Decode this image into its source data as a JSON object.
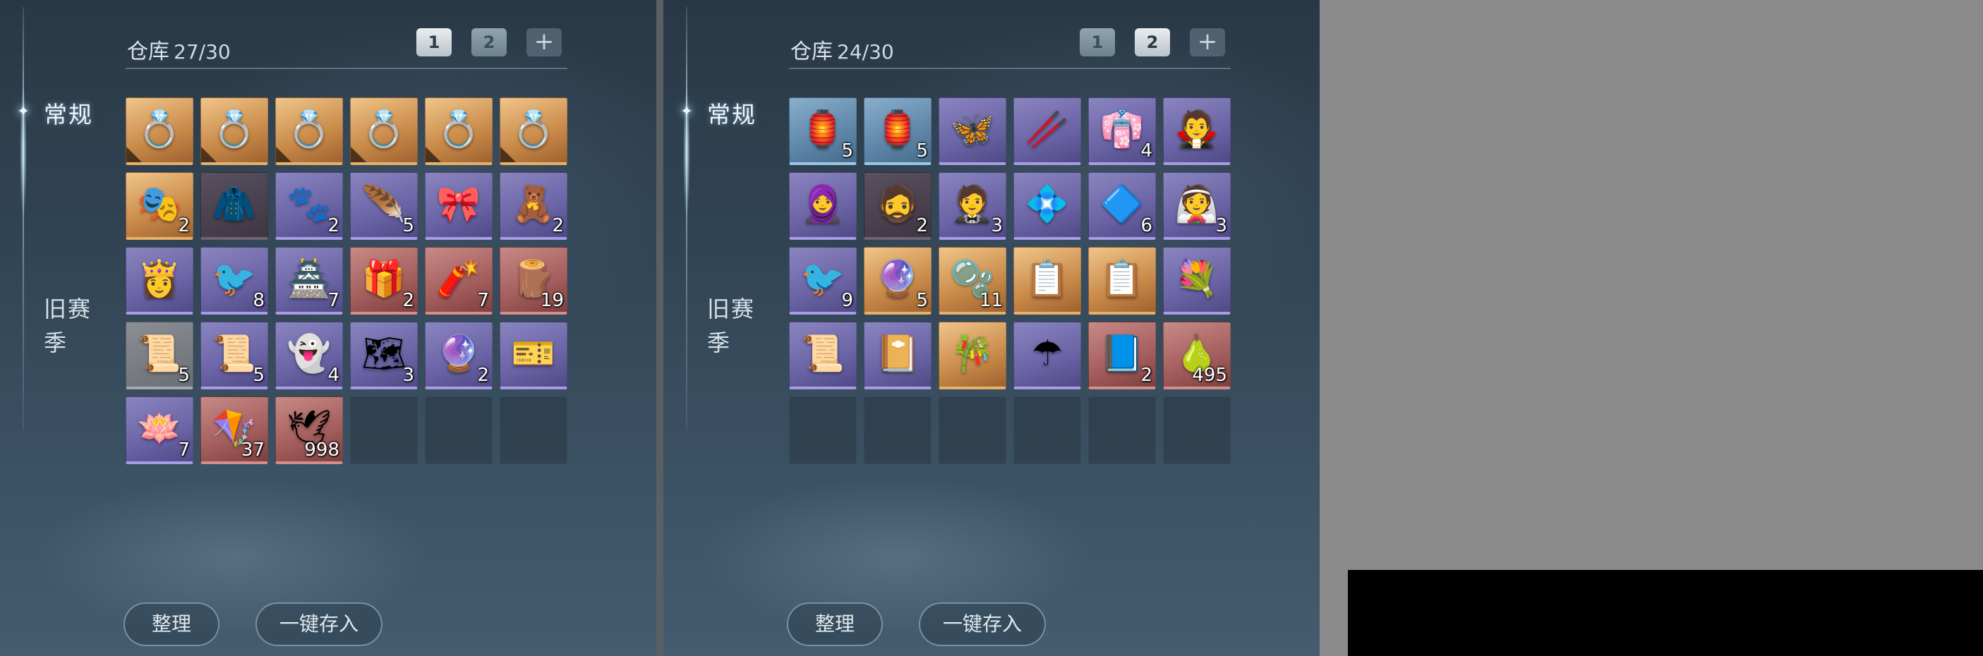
{
  "panels": [
    {
      "title": "仓库",
      "count": "27/30",
      "tabs": {
        "normal": "常规",
        "old_season": "旧赛季"
      },
      "pages": [
        "1",
        "2",
        "+"
      ],
      "active_page": "1",
      "buttons": {
        "sort": "整理",
        "store_all": "一键存入"
      },
      "items": [
        {
          "icon": "ring-icon",
          "glyph": "💍",
          "rarity": "gold",
          "qty": ""
        },
        {
          "icon": "ring-icon",
          "glyph": "💍",
          "rarity": "gold",
          "qty": ""
        },
        {
          "icon": "ring-icon",
          "glyph": "💍",
          "rarity": "gold",
          "qty": ""
        },
        {
          "icon": "ring-icon",
          "glyph": "💍",
          "rarity": "gold",
          "qty": ""
        },
        {
          "icon": "ring-icon",
          "glyph": "💍",
          "rarity": "gold",
          "qty": ""
        },
        {
          "icon": "ring-icon",
          "glyph": "💍",
          "rarity": "gold",
          "qty": ""
        },
        {
          "icon": "mask-icon",
          "glyph": "🎭",
          "rarity": "gold",
          "qty": "2"
        },
        {
          "icon": "cloak-icon",
          "glyph": "🧥",
          "rarity": "dark",
          "qty": ""
        },
        {
          "icon": "beast-icon",
          "glyph": "🐾",
          "rarity": "purple",
          "qty": "2"
        },
        {
          "icon": "feather-icon",
          "glyph": "🪶",
          "rarity": "purple",
          "qty": "5"
        },
        {
          "icon": "bow-ornament-icon",
          "glyph": "🎀",
          "rarity": "purple",
          "qty": ""
        },
        {
          "icon": "plush-icon",
          "glyph": "🧸",
          "rarity": "purple",
          "qty": "2"
        },
        {
          "icon": "character-icon",
          "glyph": "👸",
          "rarity": "purple",
          "qty": ""
        },
        {
          "icon": "bird-icon",
          "glyph": "🐦",
          "rarity": "purple",
          "qty": "8"
        },
        {
          "icon": "pavilion-icon",
          "glyph": "🏯",
          "rarity": "purple",
          "qty": "7"
        },
        {
          "icon": "gift-box-icon",
          "glyph": "🎁",
          "rarity": "red",
          "qty": "2"
        },
        {
          "icon": "firecracker-icon",
          "glyph": "🧨",
          "rarity": "red",
          "qty": "7"
        },
        {
          "icon": "scroll-tube-icon",
          "glyph": "🪵",
          "rarity": "red",
          "qty": "19"
        },
        {
          "icon": "scroll-icon",
          "glyph": "📜",
          "rarity": "grey",
          "qty": "5"
        },
        {
          "icon": "scroll-icon",
          "glyph": "📜",
          "rarity": "purple",
          "qty": "5"
        },
        {
          "icon": "spirit-icon",
          "glyph": "👻",
          "rarity": "purple",
          "qty": "4"
        },
        {
          "icon": "map-fragment-icon",
          "glyph": "🗺",
          "rarity": "purple",
          "qty": "3"
        },
        {
          "icon": "pearl-icon",
          "glyph": "🔮",
          "rarity": "purple",
          "qty": "2"
        },
        {
          "icon": "ticket-icon",
          "glyph": "🎫",
          "rarity": "purple",
          "qty": ""
        },
        {
          "icon": "lotus-icon",
          "glyph": "🪷",
          "rarity": "purple",
          "qty": "7"
        },
        {
          "icon": "kite-icon",
          "glyph": "🪁",
          "rarity": "red",
          "qty": "37"
        },
        {
          "icon": "paper-crane-icon",
          "glyph": "🕊",
          "rarity": "red",
          "qty": "998"
        },
        {
          "icon": "",
          "glyph": "",
          "rarity": "empty",
          "qty": ""
        },
        {
          "icon": "",
          "glyph": "",
          "rarity": "empty",
          "qty": ""
        },
        {
          "icon": "",
          "glyph": "",
          "rarity": "empty",
          "qty": ""
        }
      ]
    },
    {
      "title": "仓库",
      "count": "24/30",
      "tabs": {
        "normal": "常规",
        "old_season": "旧赛季"
      },
      "pages": [
        "1",
        "2",
        "+"
      ],
      "active_page": "2",
      "buttons": {
        "sort": "整理",
        "store_all": "一键存入"
      },
      "items": [
        {
          "icon": "lantern-icon",
          "glyph": "🏮",
          "rarity": "blue",
          "qty": "5"
        },
        {
          "icon": "lantern-icon",
          "glyph": "🏮",
          "rarity": "blue",
          "qty": "5"
        },
        {
          "icon": "butterfly-icon",
          "glyph": "🦋",
          "rarity": "purple",
          "qty": ""
        },
        {
          "icon": "chopsticks-icon",
          "glyph": "🥢",
          "rarity": "purple",
          "qty": ""
        },
        {
          "icon": "robe-icon",
          "glyph": "👘",
          "rarity": "purple",
          "qty": "4"
        },
        {
          "icon": "character-icon",
          "glyph": "🧛",
          "rarity": "purple",
          "qty": ""
        },
        {
          "icon": "character-icon",
          "glyph": "🧕",
          "rarity": "purple",
          "qty": ""
        },
        {
          "icon": "character-icon",
          "glyph": "🧔",
          "rarity": "dark",
          "qty": "2"
        },
        {
          "icon": "character-icon",
          "glyph": "🤵",
          "rarity": "purple",
          "qty": "3"
        },
        {
          "icon": "crystal-flower-icon",
          "glyph": "💠",
          "rarity": "purple",
          "qty": ""
        },
        {
          "icon": "crystal-shard-icon",
          "glyph": "🔷",
          "rarity": "purple",
          "qty": "6"
        },
        {
          "icon": "character-icon",
          "glyph": "👰",
          "rarity": "purple",
          "qty": "3"
        },
        {
          "icon": "bird-icon",
          "glyph": "🐦",
          "rarity": "purple",
          "qty": "9"
        },
        {
          "icon": "orb-icon",
          "glyph": "🔮",
          "rarity": "gold",
          "qty": "5"
        },
        {
          "icon": "orb-icon",
          "glyph": "🫧",
          "rarity": "gold",
          "qty": "11"
        },
        {
          "icon": "manual-icon",
          "glyph": "📋",
          "rarity": "gold",
          "qty": ""
        },
        {
          "icon": "manual-icon",
          "glyph": "📋",
          "rarity": "gold",
          "qty": ""
        },
        {
          "icon": "blue-flower-icon",
          "glyph": "💐",
          "rarity": "purple",
          "qty": ""
        },
        {
          "icon": "scroll-icon",
          "glyph": "📜",
          "rarity": "purple",
          "qty": ""
        },
        {
          "icon": "book-icon",
          "glyph": "📔",
          "rarity": "purple",
          "qty": ""
        },
        {
          "icon": "bamboo-tube-icon",
          "glyph": "🎋",
          "rarity": "gold",
          "qty": ""
        },
        {
          "icon": "umbrella-icon",
          "glyph": "☂",
          "rarity": "purple",
          "qty": ""
        },
        {
          "icon": "book-icon",
          "glyph": "📘",
          "rarity": "red",
          "qty": "2"
        },
        {
          "icon": "gourd-icon",
          "glyph": "🍐",
          "rarity": "red",
          "qty": "495"
        },
        {
          "icon": "",
          "glyph": "",
          "rarity": "empty",
          "qty": ""
        },
        {
          "icon": "",
          "glyph": "",
          "rarity": "empty",
          "qty": ""
        },
        {
          "icon": "",
          "glyph": "",
          "rarity": "empty",
          "qty": ""
        },
        {
          "icon": "",
          "glyph": "",
          "rarity": "empty",
          "qty": ""
        },
        {
          "icon": "",
          "glyph": "",
          "rarity": "empty",
          "qty": ""
        },
        {
          "icon": "",
          "glyph": "",
          "rarity": "empty",
          "qty": ""
        }
      ]
    }
  ],
  "colors": {
    "rarity_gold": "#e5b06a",
    "rarity_purple": "#a89be6",
    "rarity_red": "#d48d8a",
    "rarity_blue": "#9cc6e6",
    "empty_slot": "#283744"
  }
}
